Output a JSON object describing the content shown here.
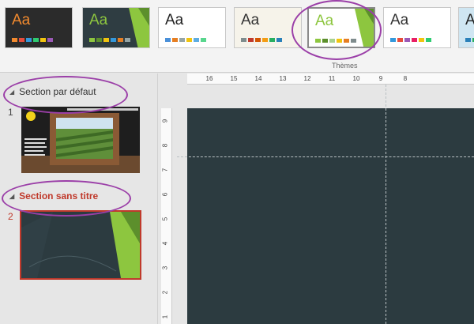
{
  "ribbon": {
    "caption": "Thèmes",
    "themes": [
      {
        "label": "Aa",
        "bg": "#2b2b2b",
        "fg": "#f28a2e",
        "selected": false
      },
      {
        "label": "Aa",
        "bg": "#2f3d42",
        "fg": "#8dc63f",
        "selected": false
      },
      {
        "label": "Aa",
        "bg": "#ffffff",
        "fg": "#222222",
        "selected": false
      },
      {
        "label": "Aa",
        "bg": "#f6f3ea",
        "fg": "#333333",
        "selected": false
      },
      {
        "label": "Aa",
        "bg": "#ffffff",
        "fg": "#8dc63f",
        "selected": true
      },
      {
        "label": "Aa",
        "bg": "#ffffff",
        "fg": "#333333",
        "selected": false
      },
      {
        "label": "Ac",
        "bg": "#cfe6f2",
        "fg": "#222222",
        "selected": false
      }
    ]
  },
  "slide_pane": {
    "sections": [
      {
        "title": "Section par défaut",
        "color": "#333333"
      },
      {
        "title": "Section sans titre",
        "color": "#c0392b"
      }
    ],
    "slides": [
      {
        "number": "1"
      },
      {
        "number": "2"
      }
    ]
  },
  "ruler": {
    "horizontal": [
      "16",
      "15",
      "14",
      "13",
      "12",
      "11",
      "10",
      "9",
      "8"
    ],
    "vertical": [
      "9",
      "8",
      "7",
      "6",
      "5",
      "4",
      "3",
      "2",
      "1"
    ]
  },
  "colors": {
    "canvas": "#2c3b40",
    "accent_green": "#8dc63f",
    "annotation": "#9b3fa8",
    "selected_border": "#c0392b"
  }
}
